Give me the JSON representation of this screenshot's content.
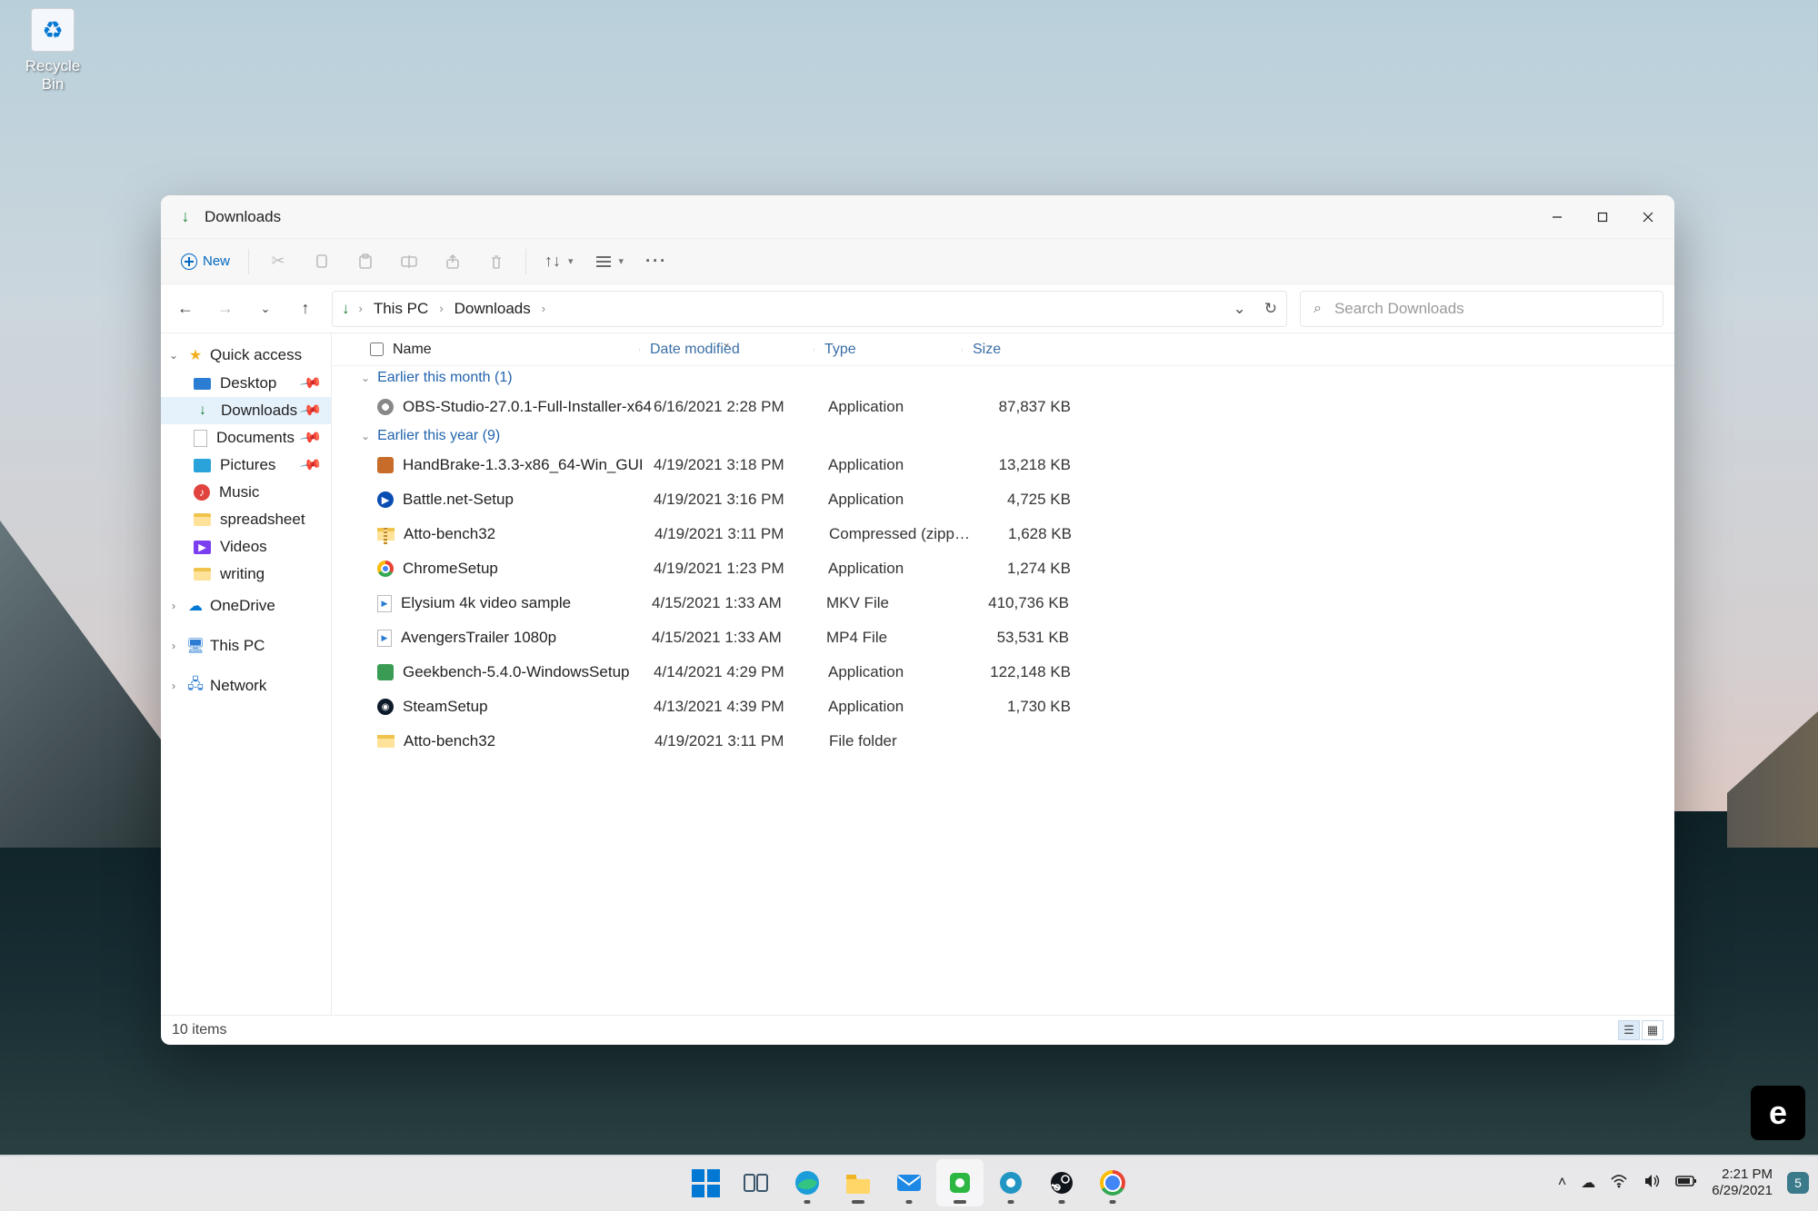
{
  "desktop": {
    "recycle_bin": "Recycle Bin"
  },
  "window": {
    "title": "Downloads",
    "toolbar": {
      "new": "New"
    },
    "breadcrumb": {
      "seg1": "This PC",
      "seg2": "Downloads"
    },
    "search_placeholder": "Search Downloads",
    "columns": {
      "name": "Name",
      "date": "Date modified",
      "type": "Type",
      "size": "Size"
    },
    "sidebar": {
      "quick_access": "Quick access",
      "items": [
        {
          "label": "Desktop",
          "pinned": true
        },
        {
          "label": "Downloads",
          "pinned": true
        },
        {
          "label": "Documents",
          "pinned": true
        },
        {
          "label": "Pictures",
          "pinned": true
        },
        {
          "label": "Music",
          "pinned": false
        },
        {
          "label": "spreadsheet",
          "pinned": false
        },
        {
          "label": "Videos",
          "pinned": false
        },
        {
          "label": "writing",
          "pinned": false
        }
      ],
      "onedrive": "OneDrive",
      "this_pc": "This PC",
      "network": "Network"
    },
    "groups": [
      {
        "title": "Earlier this month (1)",
        "files": [
          {
            "name": "OBS-Studio-27.0.1-Full-Installer-x64",
            "date": "6/16/2021 2:28 PM",
            "type": "Application",
            "size": "87,837 KB",
            "ico": "app"
          }
        ]
      },
      {
        "title": "Earlier this year (9)",
        "files": [
          {
            "name": "HandBrake-1.3.3-x86_64-Win_GUI",
            "date": "4/19/2021 3:18 PM",
            "type": "Application",
            "size": "13,218 KB",
            "ico": "hb"
          },
          {
            "name": "Battle.net-Setup",
            "date": "4/19/2021 3:16 PM",
            "type": "Application",
            "size": "4,725 KB",
            "ico": "blue"
          },
          {
            "name": "Atto-bench32",
            "date": "4/19/2021 3:11 PM",
            "type": "Compressed (zipped)…",
            "size": "1,628 KB",
            "ico": "zip"
          },
          {
            "name": "ChromeSetup",
            "date": "4/19/2021 1:23 PM",
            "type": "Application",
            "size": "1,274 KB",
            "ico": "chrome"
          },
          {
            "name": "Elysium 4k video sample",
            "date": "4/15/2021 1:33 AM",
            "type": "MKV File",
            "size": "410,736 KB",
            "ico": "mkv"
          },
          {
            "name": "AvengersTrailer 1080p",
            "date": "4/15/2021 1:33 AM",
            "type": "MP4 File",
            "size": "53,531 KB",
            "ico": "mp4"
          },
          {
            "name": "Geekbench-5.4.0-WindowsSetup",
            "date": "4/14/2021 4:29 PM",
            "type": "Application",
            "size": "122,148 KB",
            "ico": "geek"
          },
          {
            "name": "SteamSetup",
            "date": "4/13/2021 4:39 PM",
            "type": "Application",
            "size": "1,730 KB",
            "ico": "steam"
          },
          {
            "name": "Atto-bench32",
            "date": "4/19/2021 3:11 PM",
            "type": "File folder",
            "size": "",
            "ico": "folder"
          }
        ]
      }
    ],
    "status": "10 items"
  },
  "taskbar": {
    "clock_time": "2:21 PM",
    "clock_date": "6/29/2021",
    "notif_count": "5"
  },
  "watermark": "e"
}
